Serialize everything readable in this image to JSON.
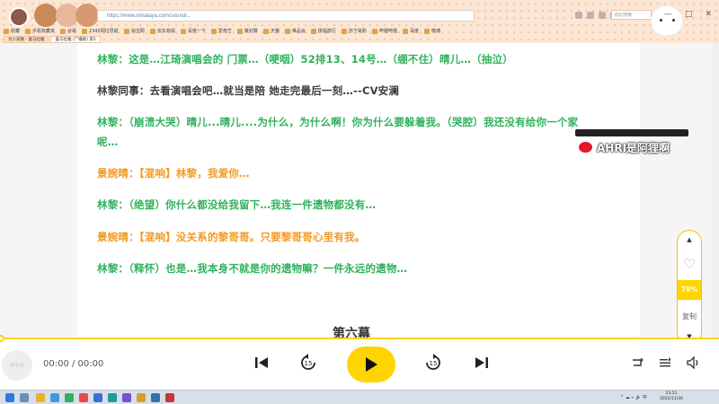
{
  "browser": {
    "url": "https://www.ximalaya.com/sound/...",
    "search_placeholder": "点此搜索",
    "window_controls": [
      "—",
      "□",
      "✕"
    ],
    "bookmarks": [
      "收藏",
      "手机收藏夹",
      "谷歌",
      "2345网址导航",
      "淘宝网",
      "京东商城",
      "百度一下",
      "爱奇艺",
      "聚划算",
      "天猫",
      "唯品会",
      "携程旅行",
      "苏宁易购",
      "哔哩哔哩",
      "百度",
      "微博"
    ],
    "tabs": [
      {
        "label": "为小说做 - 喜马拉雅",
        "active": false
      },
      {
        "label": "喜马拉雅 (广播剧) 第5",
        "active": true
      }
    ]
  },
  "article": {
    "lines": [
      {
        "text": "林黎：这是…江琦演唱会的 门票…（哽咽）52排13、14号…（绷不住）晴儿…（抽泣）",
        "color": "green"
      },
      {
        "text": "林黎同事：去看演唱会吧…就当是陪 她走完最后一刻…--CV安澜",
        "color": "dark"
      },
      {
        "text": "林黎：（崩溃大哭）晴儿...晴儿....为什么，为什么啊！你为什么要躲着我。（哭腔）我还没有给你一个家",
        "color": "green"
      },
      {
        "text": "呢…",
        "color": "green"
      },
      {
        "text": "景婉晴：【混响】林黎，我爱你…",
        "color": "orange"
      },
      {
        "text": "林黎：（绝望）你什么都没给我留下…我连一件遗物都没有…",
        "color": "green"
      },
      {
        "text": "景婉晴：【混响】没关系的黎哥哥。只要黎哥哥心里有我。",
        "color": "orange"
      },
      {
        "text": "林黎：（释怀）也是…我本身不就是你的遗物嘛？一件永远的遗物…",
        "color": "green"
      }
    ],
    "next_chapter": "第六幕"
  },
  "overlay": {
    "weibo_handle": "AHRI是阿狸啊"
  },
  "float_bar": {
    "up": "▲",
    "like": "♡",
    "percent": "79%",
    "copy": "复制",
    "down": "▼"
  },
  "player": {
    "cover_text": "◎◎◎",
    "time": "00:00 / 00:00",
    "colors": {
      "accent": "#ffd400"
    }
  },
  "taskbar": {
    "time": "23:51",
    "date": "2022/11/30",
    "tray": "^ ☁ ⌁ 🔊 中"
  },
  "colors": {
    "green": "#2fb25c",
    "orange": "#f29a23",
    "dark": "#3a3a3a",
    "accent": "#ffd400"
  }
}
